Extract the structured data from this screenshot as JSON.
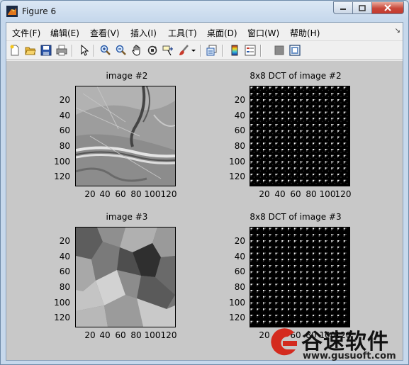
{
  "window": {
    "title": "Figure 6"
  },
  "menu": [
    "文件(F)",
    "编辑(E)",
    "查看(V)",
    "插入(I)",
    "工具(T)",
    "桌面(D)",
    "窗口(W)",
    "帮助(H)"
  ],
  "toolbar": [
    "new-figure-icon",
    "open-file-icon",
    "save-icon",
    "print-icon",
    "edit-plot-arrow-icon",
    "zoom-in-icon",
    "zoom-out-icon",
    "pan-hand-icon",
    "rotate-3d-icon",
    "data-cursor-icon",
    "brush-icon",
    "print-preview-icon",
    "colorbar-icon",
    "legend-icon",
    "hide-plot-tools-icon",
    "show-plot-tools-icon"
  ],
  "axes": [
    {
      "title": "image #2",
      "yticks": [
        "20",
        "40",
        "60",
        "80",
        "100",
        "120"
      ],
      "xticks": [
        "20",
        "40",
        "60",
        "80",
        "100",
        "120"
      ]
    },
    {
      "title": "8x8 DCT of image #2",
      "yticks": [
        "20",
        "40",
        "60",
        "80",
        "100",
        "120"
      ],
      "xticks": [
        "20",
        "40",
        "60",
        "80",
        "100",
        "120"
      ]
    },
    {
      "title": "image #3",
      "yticks": [
        "20",
        "40",
        "60",
        "80",
        "100",
        "120"
      ],
      "xticks": [
        "20",
        "40",
        "60",
        "80",
        "100",
        "120"
      ]
    },
    {
      "title": "8x8 DCT of image #3",
      "yticks": [
        "20",
        "40",
        "60",
        "80",
        "100",
        "120"
      ],
      "xticks": [
        "20",
        "40",
        "60",
        "80",
        "100",
        "120"
      ]
    }
  ],
  "watermark": {
    "name": "谷速软件",
    "url": "www.gusuoft.com"
  },
  "colors": {
    "figure_bg": "#c8c8c8",
    "close_button": "#c8473a",
    "watermark_red": "#d42a1e"
  }
}
